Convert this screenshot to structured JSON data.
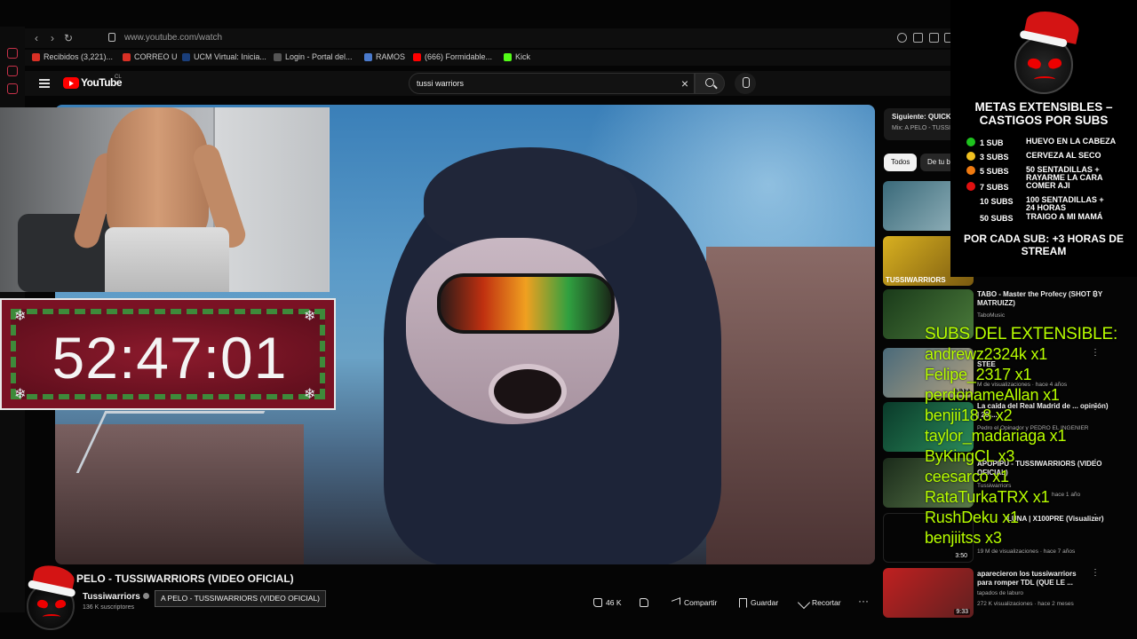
{
  "browser": {
    "url": "www.youtube.com/watch",
    "bookmarks": [
      {
        "label": "Recibidos (3,221)...",
        "color": "#d93025"
      },
      {
        "label": "CORREO U",
        "color": "#d93025"
      },
      {
        "label": "UCM Virtual: Inicia...",
        "color": "#1a3e7a"
      },
      {
        "label": "Login - Portal del...",
        "color": "#555555"
      },
      {
        "label": "RAMOS",
        "color": "#4a7acc"
      },
      {
        "label": "(666) Formidable...",
        "color": "#ff0000"
      },
      {
        "label": "Kick",
        "color": "#53fc18"
      }
    ]
  },
  "youtube": {
    "logo_text": "YouTube",
    "region": "CL",
    "search_value": "tussi warriors"
  },
  "timer": {
    "value": "52:47:01"
  },
  "video": {
    "title": "PELO - TUSSIWARRIORS (VIDEO OFICIAL)",
    "channel": "Tussiwarriors",
    "subscribers": "136 K suscriptores",
    "tooltip": "A PELO - TUSSIWARRIORS (VIDEO OFICIAL)",
    "actions": {
      "likes": "46 K",
      "share": "Compartir",
      "save": "Guardar",
      "clip": "Recortar"
    }
  },
  "sidebar": {
    "next_label": "Siguiente: QUICK",
    "next_sub": "Mix: A PELO - TUSSI",
    "chips": [
      "Todos",
      "De tu b"
    ],
    "items": [
      {
        "title": "",
        "meta1": "",
        "meta2": "",
        "duration": "",
        "thumb": "#4a7a8a"
      },
      {
        "title": "",
        "meta1": "",
        "meta2": "",
        "duration": "",
        "thumb": "#c8a020",
        "thumb_label": "TUSSIWARRIORS"
      },
      {
        "title": "TABO - Master the Profecy (SHOT BY MATRUIZZ)",
        "meta1": "TaboMusic",
        "meta2": "",
        "duration": "",
        "thumb": "#2a4a2a"
      },
      {
        "title": "STEE",
        "meta1": "",
        "meta2": "M de visualizaciones · hace 4 años",
        "duration": "3:17",
        "thumb": "#6a8a9a"
      },
      {
        "title": "La caída del Real Madrid de ... opinión) | 20-...",
        "meta1": "Pedro el Opinador y PEDRO EL INGENIER",
        "meta2": "",
        "duration": "",
        "thumb": "#1a5a3a"
      },
      {
        "title": "APOPIPU - TUSSIWARRIORS (VIDEO OFICIAL)",
        "meta1": "Tussiwarriors",
        "meta2": "hace 1 año",
        "duration": "",
        "thumb": "#2a3a2a"
      },
      {
        "title": "LUNA | X100PRE (Visualizer)",
        "meta1": "",
        "meta2": "19 M de visualizaciones · hace 7 años",
        "duration": "3:50",
        "thumb": "#050505"
      },
      {
        "title": "aparecieron los tussiwarriors para romper TDL (QUE LE ...",
        "meta1": "tapados de laburo",
        "meta2": "272 K visualizaciones · hace 2 meses",
        "duration": "9:33",
        "thumb": "#a02020"
      }
    ]
  },
  "goals": {
    "title": "METAS EXTENSIBLES – CASTIGOS POR SUBS",
    "items": [
      {
        "subs": "1 SUB",
        "reward": "HUEVO EN LA CABEZA",
        "color": "#1ec21e"
      },
      {
        "subs": "3 SUBS",
        "reward": "CERVEZA AL SECO",
        "color": "#f0c020"
      },
      {
        "subs": "5 SUBS",
        "reward": "50 SENTADILLAS + RAYARME LA CARA",
        "color": "#f07a10"
      },
      {
        "subs": "7 SUBS",
        "reward": "COMER AJI",
        "color": "#e01010"
      },
      {
        "subs": "10 SUBS",
        "reward": "100 SENTADILLAS + 24 HORAS",
        "color": "#000000"
      },
      {
        "subs": "50 SUBS",
        "reward": "TRAIGO A MI MAMÁ",
        "color": "#000000"
      }
    ],
    "footer": "POR CADA SUB: +3 HORAS DE STREAM"
  },
  "extensible": {
    "title": "SUBS DEL EXTENSIBLE:",
    "entries": [
      "andrewz2324k x1",
      "Felipe_2317 x1",
      "perdonameAllan x1",
      "benjii18.8 x2",
      "taylor_madariaga x1",
      "ByKingCL x3",
      "ceesarco x1",
      "RataTurkaTRX x1",
      "RushDeku x1",
      "benjiitss x3"
    ]
  },
  "colors": {
    "accent": "#ff0000",
    "overlay_text": "#b8ff00",
    "timer_bg": "#7a1224"
  }
}
